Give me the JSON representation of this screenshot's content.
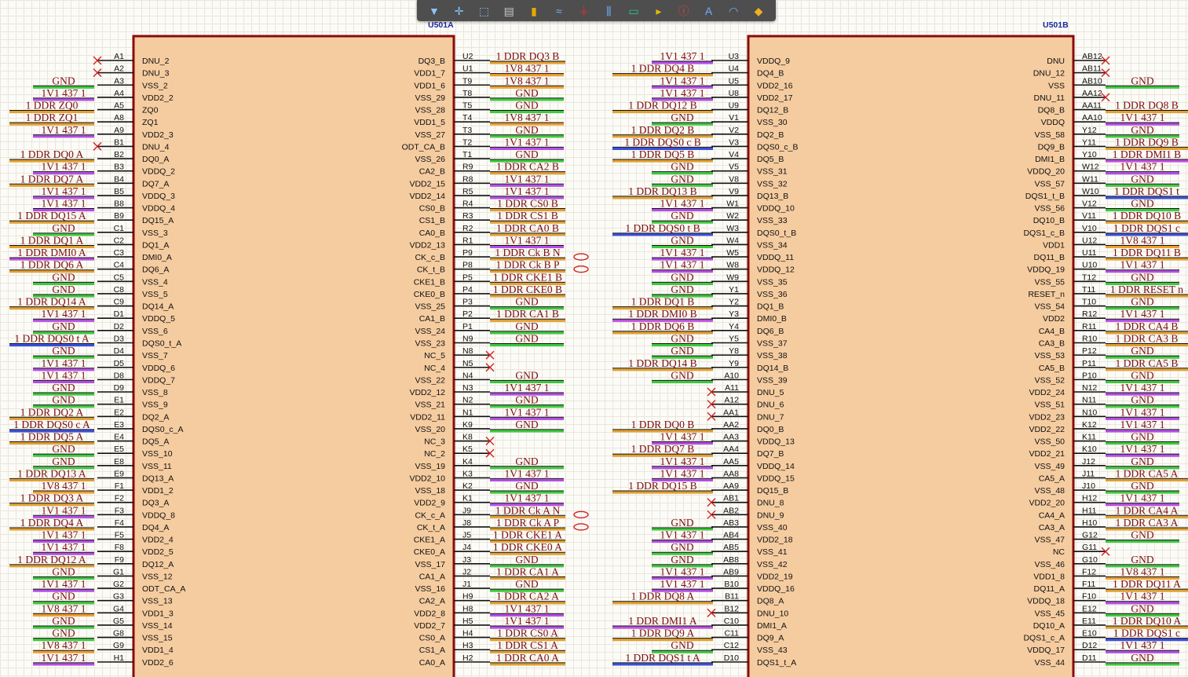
{
  "toolbar": [
    {
      "name": "filter-icon",
      "glyph": "▼",
      "color": "#8ec2ff"
    },
    {
      "name": "move-cross-icon",
      "glyph": "✛",
      "color": "#8ec2ff"
    },
    {
      "name": "select-rect-icon",
      "glyph": "⬚",
      "color": "#8ec2ff"
    },
    {
      "name": "align-icon",
      "glyph": "▤",
      "color": "#c8c8c8"
    },
    {
      "name": "place-part-icon",
      "glyph": "▮",
      "color": "#e8a800"
    },
    {
      "name": "wire-icon",
      "glyph": "≈",
      "color": "#6fb0ff"
    },
    {
      "name": "power-port-icon",
      "glyph": "⏚",
      "color": "#e03030"
    },
    {
      "name": "bus-icon",
      "glyph": "⫼",
      "color": "#6fb0ff"
    },
    {
      "name": "harness-icon",
      "glyph": "▭",
      "color": "#2bc48a"
    },
    {
      "name": "port-icon",
      "glyph": "▸",
      "color": "#e8b800"
    },
    {
      "name": "no-erc-icon",
      "glyph": "ⓘ",
      "color": "#e04040"
    },
    {
      "name": "text-icon",
      "glyph": "A",
      "color": "#6fb0ff"
    },
    {
      "name": "arc-icon",
      "glyph": "◠",
      "color": "#6fb0ff"
    },
    {
      "name": "directive-icon",
      "glyph": "◆",
      "color": "#f0b020"
    }
  ],
  "parts": [
    {
      "designator": "U501A",
      "left": [
        [
          "A1",
          "DNU_2",
          null
        ],
        [
          "A2",
          "DNU_3",
          null
        ],
        [
          "A3",
          "VSS_2",
          "GND"
        ],
        [
          "A4",
          "VDD2_2",
          "1V1_437_1"
        ],
        [
          "A5",
          "ZQ0",
          "1_DDR_ZQ0"
        ],
        [
          "A8",
          "ZQ1",
          "1_DDR_ZQ1"
        ],
        [
          "A9",
          "VDD2_3",
          "1V1_437_1"
        ],
        [
          "B1",
          "DNU_4",
          null
        ],
        [
          "B2",
          "DQ0_A",
          "1_DDR_DQ0_A"
        ],
        [
          "B3",
          "VDDQ_2",
          "1V1_437_1"
        ],
        [
          "B4",
          "DQ7_A",
          "1_DDR_DQ7_A"
        ],
        [
          "B5",
          "VDDQ_3",
          "1V1_437_1"
        ],
        [
          "B8",
          "VDDQ_4",
          "1V1_437_1"
        ],
        [
          "B9",
          "DQ15_A",
          "1_DDR_DQ15_A"
        ],
        [
          "C1",
          "VSS_3",
          "GND"
        ],
        [
          "C2",
          "DQ1_A",
          "1_DDR_DQ1_A"
        ],
        [
          "C3",
          "DMI0_A",
          "1_DDR_DMI0_A"
        ],
        [
          "C4",
          "DQ6_A",
          "1_DDR_DQ6_A"
        ],
        [
          "C5",
          "VSS_4",
          "GND"
        ],
        [
          "C8",
          "VSS_5",
          "GND"
        ],
        [
          "C9",
          "DQ14_A",
          "1_DDR_DQ14_A"
        ],
        [
          "D1",
          "VDDQ_5",
          "1V1_437_1"
        ],
        [
          "D2",
          "VSS_6",
          "GND"
        ],
        [
          "D3",
          "DQS0_t_A",
          "1_DDR_DQS0_t_A"
        ],
        [
          "D4",
          "VSS_7",
          "GND"
        ],
        [
          "D5",
          "VDDQ_6",
          "1V1_437_1"
        ],
        [
          "D8",
          "VDDQ_7",
          "1V1_437_1"
        ],
        [
          "D9",
          "VSS_8",
          "GND"
        ],
        [
          "E1",
          "VSS_9",
          "GND"
        ],
        [
          "E2",
          "DQ2_A",
          "1_DDR_DQ2_A"
        ],
        [
          "E3",
          "DQS0_c_A",
          "1_DDR_DQS0_c_A"
        ],
        [
          "E4",
          "DQ5_A",
          "1_DDR_DQ5_A"
        ],
        [
          "E5",
          "VSS_10",
          "GND"
        ],
        [
          "E8",
          "VSS_11",
          "GND"
        ],
        [
          "E9",
          "DQ13_A",
          "1_DDR_DQ13_A"
        ],
        [
          "F1",
          "VDD1_2",
          "1V8_437_1"
        ],
        [
          "F2",
          "DQ3_A",
          "1_DDR_DQ3_A"
        ],
        [
          "F3",
          "VDDQ_8",
          "1V1_437_1"
        ],
        [
          "F4",
          "DQ4_A",
          "1_DDR_DQ4_A"
        ],
        [
          "F5",
          "VDD2_4",
          "1V1_437_1"
        ],
        [
          "F8",
          "VDD2_5",
          "1V1_437_1"
        ],
        [
          "F9",
          "DQ12_A",
          "1_DDR_DQ12_A"
        ],
        [
          "G1",
          "VSS_12",
          "GND"
        ],
        [
          "G2",
          "ODT_CA_A",
          "1V1_437_1"
        ],
        [
          "G3",
          "VSS_13",
          "GND"
        ],
        [
          "G4",
          "VDD1_3",
          "1V8_437_1"
        ],
        [
          "G5",
          "VSS_14",
          "GND"
        ],
        [
          "G8",
          "VSS_15",
          "GND"
        ],
        [
          "G9",
          "VDD1_4",
          "1V8_437_1"
        ],
        [
          "H1",
          "VDD2_6",
          "1V1_437_1"
        ]
      ],
      "right": [
        [
          "U2",
          "DQ3_B",
          "1_DDR_DQ3_B"
        ],
        [
          "U1",
          "VDD1_7",
          "1V8_437_1"
        ],
        [
          "T9",
          "VDD1_6",
          "1V8_437_1"
        ],
        [
          "T8",
          "VSS_29",
          "GND"
        ],
        [
          "T5",
          "VSS_28",
          "GND"
        ],
        [
          "T4",
          "VDD1_5",
          "1V8_437_1"
        ],
        [
          "T3",
          "VSS_27",
          "GND"
        ],
        [
          "T2",
          "ODT_CA_B",
          "1V1_437_1"
        ],
        [
          "T1",
          "VSS_26",
          "GND"
        ],
        [
          "R9",
          "CA2_B",
          "1_DDR_CA2_B"
        ],
        [
          "R8",
          "VDD2_15",
          "1V1_437_1"
        ],
        [
          "R5",
          "VDD2_14",
          "1V1_437_1"
        ],
        [
          "R4",
          "CS0_B",
          "1_DDR_CS0_B"
        ],
        [
          "R3",
          "CS1_B",
          "1_DDR_CS1_B"
        ],
        [
          "R2",
          "CA0_B",
          "1_DDR_CA0_B"
        ],
        [
          "R1",
          "VDD2_13",
          "1V1_437_1"
        ],
        [
          "P9",
          "CK_c_B",
          "1_DDR_Ck_B_N"
        ],
        [
          "P8",
          "CK_t_B",
          "1_DDR_Ck_B_P"
        ],
        [
          "P5",
          "CKE1_B",
          "1_DDR_CKE1_B"
        ],
        [
          "P4",
          "CKE0_B",
          "1_DDR_CKE0_B"
        ],
        [
          "P3",
          "VSS_25",
          "GND"
        ],
        [
          "P2",
          "CA1_B",
          "1_DDR_CA1_B"
        ],
        [
          "P1",
          "VSS_24",
          "GND"
        ],
        [
          "N9",
          "VSS_23",
          "GND"
        ],
        [
          "N8",
          "NC_5",
          null
        ],
        [
          "N5",
          "NC_4",
          null
        ],
        [
          "N4",
          "VSS_22",
          "GND"
        ],
        [
          "N3",
          "VDD2_12",
          "1V1_437_1"
        ],
        [
          "N2",
          "VSS_21",
          "GND"
        ],
        [
          "N1",
          "VDD2_11",
          "1V1_437_1"
        ],
        [
          "K9",
          "VSS_20",
          "GND"
        ],
        [
          "K8",
          "NC_3",
          null
        ],
        [
          "K5",
          "NC_2",
          null
        ],
        [
          "K4",
          "VSS_19",
          "GND"
        ],
        [
          "K3",
          "VDD2_10",
          "1V1_437_1"
        ],
        [
          "K2",
          "VSS_18",
          "GND"
        ],
        [
          "K1",
          "VDD2_9",
          "1V1_437_1"
        ],
        [
          "J9",
          "CK_c_A",
          "1_DDR_Ck_A_N"
        ],
        [
          "J8",
          "CK_t_A",
          "1_DDR_Ck_A_P"
        ],
        [
          "J5",
          "CKE1_A",
          "1_DDR_CKE1_A"
        ],
        [
          "J4",
          "CKE0_A",
          "1_DDR_CKE0_A"
        ],
        [
          "J3",
          "VSS_17",
          "GND"
        ],
        [
          "J2",
          "CA1_A",
          "1_DDR_CA1_A"
        ],
        [
          "J1",
          "VSS_16",
          "GND"
        ],
        [
          "H9",
          "CA2_A",
          "1_DDR_CA2_A"
        ],
        [
          "H8",
          "VDD2_8",
          "1V1_437_1"
        ],
        [
          "H5",
          "VDD2_7",
          "1V1_437_1"
        ],
        [
          "H4",
          "CS0_A",
          "1_DDR_CS0_A"
        ],
        [
          "H3",
          "CS1_A",
          "1_DDR_CS1_A"
        ],
        [
          "H2",
          "CA0_A",
          "1_DDR_CA0_A"
        ]
      ]
    },
    {
      "designator": "U501B",
      "left": [
        [
          "U3",
          "VDDQ_9",
          "1V1_437_1"
        ],
        [
          "U4",
          "DQ4_B",
          "1_DDR_DQ4_B"
        ],
        [
          "U5",
          "VDD2_16",
          "1V1_437_1"
        ],
        [
          "U8",
          "VDD2_17",
          "1V1_437_1"
        ],
        [
          "U9",
          "DQ12_B",
          "1_DDR_DQ12_B"
        ],
        [
          "V1",
          "VSS_30",
          "GND"
        ],
        [
          "V2",
          "DQ2_B",
          "1_DDR_DQ2_B"
        ],
        [
          "V3",
          "DQS0_c_B",
          "1_DDR_DQS0_c_B"
        ],
        [
          "V4",
          "DQ5_B",
          "1_DDR_DQ5_B"
        ],
        [
          "V5",
          "VSS_31",
          "GND"
        ],
        [
          "V8",
          "VSS_32",
          "GND"
        ],
        [
          "V9",
          "DQ13_B",
          "1_DDR_DQ13_B"
        ],
        [
          "W1",
          "VDDQ_10",
          "1V1_437_1"
        ],
        [
          "W2",
          "VSS_33",
          "GND"
        ],
        [
          "W3",
          "DQS0_t_B",
          "1_DDR_DQS0_t_B"
        ],
        [
          "W4",
          "VSS_34",
          "GND"
        ],
        [
          "W5",
          "VDDQ_11",
          "1V1_437_1"
        ],
        [
          "W8",
          "VDDQ_12",
          "1V1_437_1"
        ],
        [
          "W9",
          "VSS_35",
          "GND"
        ],
        [
          "Y1",
          "VSS_36",
          "GND"
        ],
        [
          "Y2",
          "DQ1_B",
          "1_DDR_DQ1_B"
        ],
        [
          "Y3",
          "DMI0_B",
          "1_DDR_DMI0_B"
        ],
        [
          "Y4",
          "DQ6_B",
          "1_DDR_DQ6_B"
        ],
        [
          "Y5",
          "VSS_37",
          "GND"
        ],
        [
          "Y8",
          "VSS_38",
          "GND"
        ],
        [
          "Y9",
          "DQ14_B",
          "1_DDR_DQ14_B"
        ],
        [
          "A10",
          "VSS_39",
          "GND"
        ],
        [
          "A11",
          "DNU_5",
          null
        ],
        [
          "A12",
          "DNU_6",
          null
        ],
        [
          "AA1",
          "DNU_7",
          null
        ],
        [
          "AA2",
          "DQ0_B",
          "1_DDR_DQ0_B"
        ],
        [
          "AA3",
          "VDDQ_13",
          "1V1_437_1"
        ],
        [
          "AA4",
          "DQ7_B",
          "1_DDR_DQ7_B"
        ],
        [
          "AA5",
          "VDDQ_14",
          "1V1_437_1"
        ],
        [
          "AA8",
          "VDDQ_15",
          "1V1_437_1"
        ],
        [
          "AA9",
          "DQ15_B",
          "1_DDR_DQ15_B"
        ],
        [
          "AB1",
          "DNU_8",
          null
        ],
        [
          "AB2",
          "DNU_9",
          null
        ],
        [
          "AB3",
          "VSS_40",
          "GND"
        ],
        [
          "AB4",
          "VDD2_18",
          "1V1_437_1"
        ],
        [
          "AB5",
          "VSS_41",
          "GND"
        ],
        [
          "AB8",
          "VSS_42",
          "GND"
        ],
        [
          "AB9",
          "VDD2_19",
          "1V1_437_1"
        ],
        [
          "B10",
          "VDDQ_16",
          "1V1_437_1"
        ],
        [
          "B11",
          "DQ8_A",
          "1_DDR_DQ8_A"
        ],
        [
          "B12",
          "DNU_10",
          null
        ],
        [
          "C10",
          "DMI1_A",
          "1_DDR_DMI1_A"
        ],
        [
          "C11",
          "DQ9_A",
          "1_DDR_DQ9_A"
        ],
        [
          "C12",
          "VSS_43",
          "GND"
        ],
        [
          "D10",
          "DQS1_t_A",
          "1_DDR_DQS1_t_A"
        ]
      ],
      "right": [
        [
          "AB12",
          "DNU",
          null
        ],
        [
          "AB11",
          "DNU_12",
          null
        ],
        [
          "AB10",
          "VSS",
          "GND"
        ],
        [
          "AA12",
          "DNU_11",
          null
        ],
        [
          "AA11",
          "DQ8_B",
          "1_DDR_DQ8_B"
        ],
        [
          "AA10",
          "VDDQ",
          "1V1_437_1"
        ],
        [
          "Y12",
          "VSS_58",
          "GND"
        ],
        [
          "Y11",
          "DQ9_B",
          "1_DDR_DQ9_B"
        ],
        [
          "Y10",
          "DMI1_B",
          "1_DDR_DMI1_B"
        ],
        [
          "W12",
          "VDDQ_20",
          "1V1_437_1"
        ],
        [
          "W11",
          "VSS_57",
          "GND"
        ],
        [
          "W10",
          "DQS1_t_B",
          "1_DDR_DQS1_t_"
        ],
        [
          "V12",
          "VSS_56",
          "GND"
        ],
        [
          "V11",
          "DQ10_B",
          "1_DDR_DQ10_B"
        ],
        [
          "V10",
          "DQS1_c_B",
          "1_DDR_DQS1_c_"
        ],
        [
          "U12",
          "VDD1",
          "1V8_437_1"
        ],
        [
          "U11",
          "DQ11_B",
          "1_DDR_DQ11_B"
        ],
        [
          "U10",
          "VDDQ_19",
          "1V1_437_1"
        ],
        [
          "T12",
          "VSS_55",
          "GND"
        ],
        [
          "T11",
          "RESET_n",
          "1_DDR_RESET_n"
        ],
        [
          "T10",
          "VSS_54",
          "GND"
        ],
        [
          "R12",
          "VDD2",
          "1V1_437_1"
        ],
        [
          "R11",
          "CA4_B",
          "1_DDR_CA4_B"
        ],
        [
          "R10",
          "CA3_B",
          "1_DDR_CA3_B"
        ],
        [
          "P12",
          "VSS_53",
          "GND"
        ],
        [
          "P11",
          "CA5_B",
          "1_DDR_CA5_B"
        ],
        [
          "P10",
          "VSS_52",
          "GND"
        ],
        [
          "N12",
          "VDD2_24",
          "1V1_437_1"
        ],
        [
          "N11",
          "VSS_51",
          "GND"
        ],
        [
          "N10",
          "VDD2_23",
          "1V1_437_1"
        ],
        [
          "K12",
          "VDD2_22",
          "1V1_437_1"
        ],
        [
          "K11",
          "VSS_50",
          "GND"
        ],
        [
          "K10",
          "VDD2_21",
          "1V1_437_1"
        ],
        [
          "J12",
          "VSS_49",
          "GND"
        ],
        [
          "J11",
          "CA5_A",
          "1_DDR_CA5_A"
        ],
        [
          "J10",
          "VSS_48",
          "GND"
        ],
        [
          "H12",
          "VDD2_20",
          "1V1_437_1"
        ],
        [
          "H11",
          "CA4_A",
          "1_DDR_CA4_A"
        ],
        [
          "H10",
          "CA3_A",
          "1_DDR_CA3_A"
        ],
        [
          "G12",
          "VSS_47",
          "GND"
        ],
        [
          "G11",
          "NC",
          null
        ],
        [
          "G10",
          "VSS_46",
          "GND"
        ],
        [
          "F12",
          "VDD1_8",
          "1V8_437_1"
        ],
        [
          "F11",
          "DQ11_A",
          "1_DDR_DQ11_A"
        ],
        [
          "F10",
          "VDDQ_18",
          "1V1_437_1"
        ],
        [
          "E12",
          "VSS_45",
          "GND"
        ],
        [
          "E11",
          "DQ10_A",
          "1_DDR_DQ10_A"
        ],
        [
          "E10",
          "DQS1_c_A",
          "1_DDR_DQS1_c_"
        ],
        [
          "D12",
          "VDDQ_17",
          "1V1_437_1"
        ],
        [
          "D11",
          "VSS_44",
          "GND"
        ]
      ]
    }
  ],
  "colors": {
    "body_fill": "#f5cca0",
    "body_border": "#8a0b0b",
    "pin_line": "#111111",
    "net_text": "#7a0d0d",
    "gnd": "#3ec93e",
    "v1v1": "#b44ee6",
    "v1v8": "#f0a030",
    "signal": "#e0a030",
    "dqs": "#3a50d8",
    "dmi": "#c050e0",
    "no_connect": "#d02020",
    "designator": "#1b2a9e",
    "grid": "#ece6da"
  }
}
